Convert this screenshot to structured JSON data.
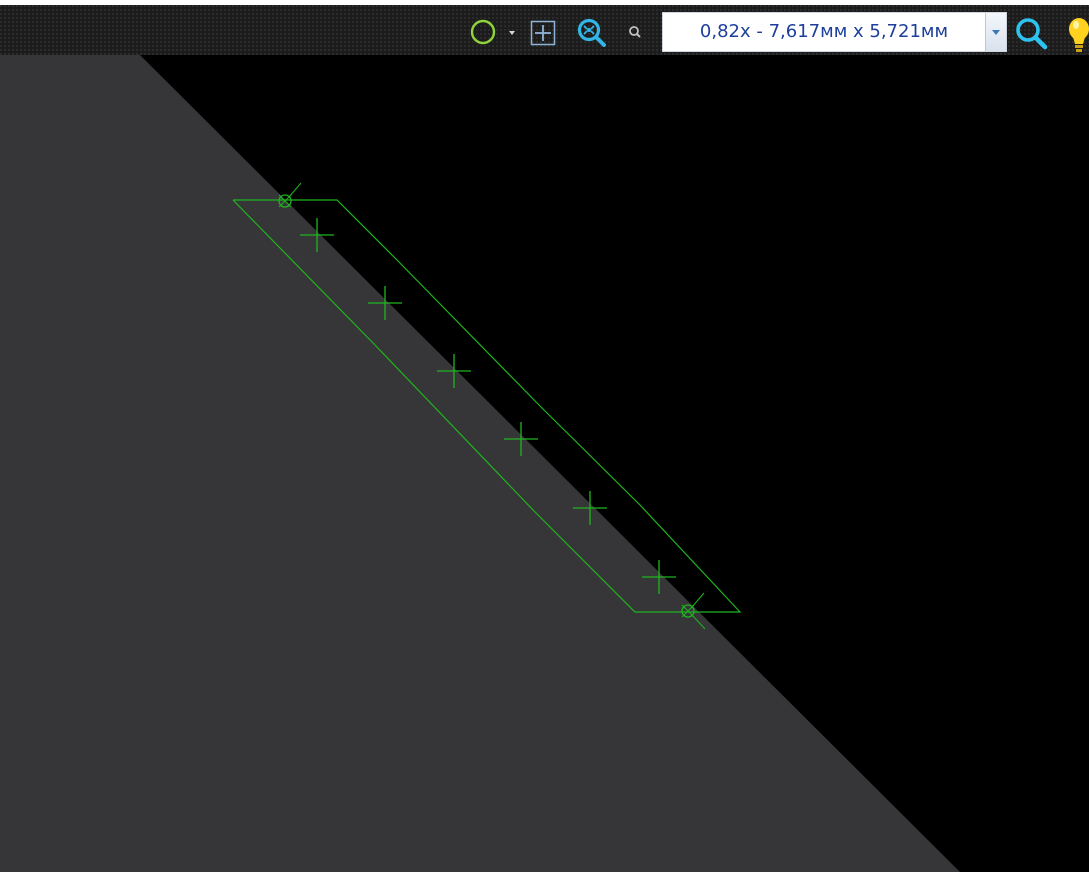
{
  "toolbar": {
    "zoom_display": "0,82x - 7,617мм x 5,721мм",
    "icons": {
      "shape": "circle-shape-icon",
      "shape_dropdown": "dropdown-arrow-icon",
      "crosshair": "crosshair-icon",
      "zoom_fit": "zoom-fit-icon",
      "small_search": "small-magnifier-icon",
      "zoom_dropdown": "chevron-down-icon",
      "zoom": "magnifier-icon",
      "tip": "lightbulb-icon"
    }
  },
  "canvas": {
    "background_color": "#000000",
    "surface_color": "#363537",
    "outline_color": "#1fb51f",
    "cross_marker_count": 6,
    "endpoint_marker_count": 2
  }
}
